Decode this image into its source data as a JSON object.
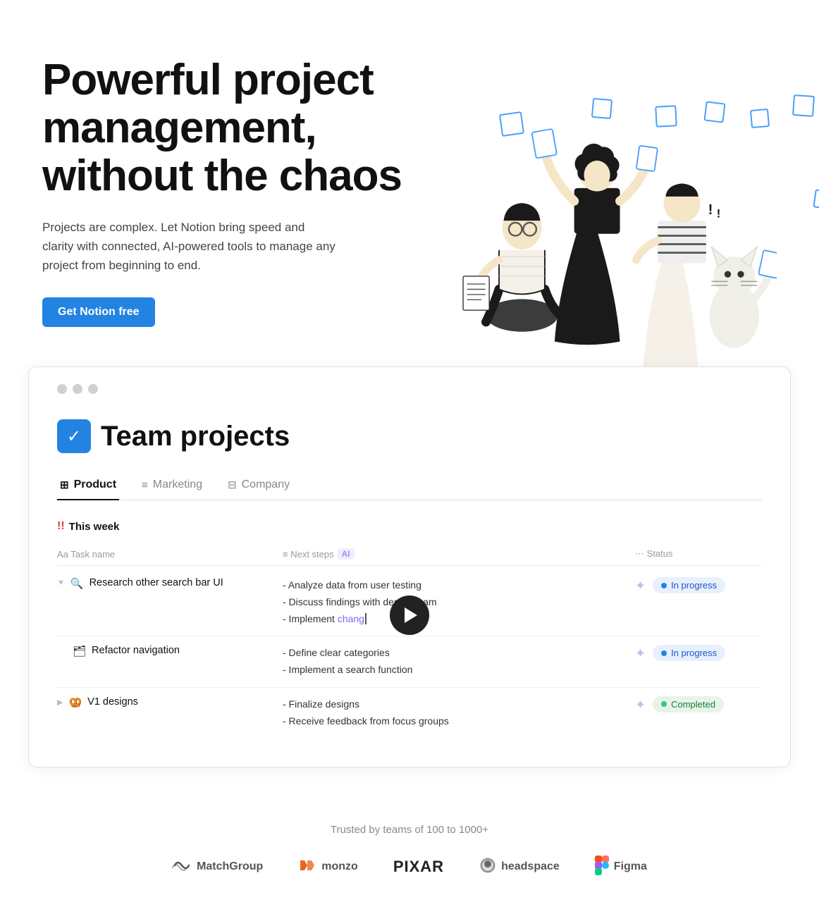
{
  "hero": {
    "title": "Powerful project management, without the chaos",
    "subtitle": "Projects are complex. Let Notion bring speed and clarity with connected, AI-powered tools to manage any project from beginning to end.",
    "cta_label": "Get Notion free"
  },
  "app": {
    "window_title": "Team projects",
    "project_icon": "✓",
    "tabs": [
      {
        "label": "Product",
        "icon": "⊞",
        "active": true
      },
      {
        "label": "Marketing",
        "icon": "≡",
        "active": false
      },
      {
        "label": "Company",
        "icon": "⊟",
        "active": false
      }
    ],
    "section_label": "This week",
    "table_headers": [
      "Aa Task name",
      "≡ Next steps",
      "⋯ Status"
    ],
    "rows": [
      {
        "expanded": true,
        "expand_icon": "▼",
        "emoji": "🔍",
        "name": "Research other search bar UI",
        "steps": "- Analyze data from user testing\n- Discuss findings with design team\n- Implement chang",
        "steps_highlight": "chang",
        "status": "In progress",
        "status_type": "inprogress"
      },
      {
        "expanded": false,
        "expand_icon": "",
        "emoji": "🗂",
        "name": "Refactor navigation",
        "steps": "- Define clear categories\n- Implement a search function",
        "status": "In progress",
        "status_type": "inprogress"
      },
      {
        "expanded": false,
        "expand_icon": "▶",
        "emoji": "🥨",
        "name": "V1 designs",
        "steps": "- Finalize designs\n- Receive feedback from focus groups",
        "status": "Completed",
        "status_type": "completed"
      }
    ]
  },
  "trusted": {
    "label": "Trusted by teams of 100 to 1000+",
    "logos": [
      {
        "name": "MatchGroup",
        "icon": "matchgroup"
      },
      {
        "name": "monzo",
        "icon": "monzo"
      },
      {
        "name": "PIXAR",
        "icon": "pixar"
      },
      {
        "name": "headspace",
        "icon": "headspace"
      },
      {
        "name": "Figma",
        "icon": "figma"
      }
    ]
  }
}
